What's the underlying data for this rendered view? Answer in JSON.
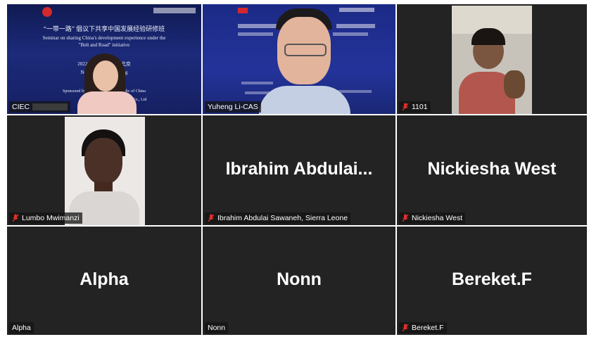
{
  "tiles": [
    {
      "name": "CIEC",
      "muted": false
    },
    {
      "name": "Yuheng Li-CAS",
      "muted": false
    },
    {
      "name": "1101",
      "muted": true
    },
    {
      "name": "Lumbo Mwimanzi",
      "muted": true
    },
    {
      "name": "Ibrahim Abdulai Sawaneh, Sierra Leone",
      "muted": true,
      "display": "Ibrahim  Abdulai..."
    },
    {
      "name": "Nickiesha West",
      "muted": true,
      "display": "Nickiesha West"
    },
    {
      "name": "Alpha",
      "muted": false,
      "display": "Alpha"
    },
    {
      "name": "Nonn",
      "muted": false,
      "display": "Nonn"
    },
    {
      "name": "Bereket.F",
      "muted": true,
      "display": "Bereket.F"
    }
  ],
  "slide": {
    "title_cn": "“一带一路” 倡议下共享中国发展经验研修班",
    "title_en_1": "Seminar on sharing China's development experience under the",
    "title_en_2": "\"Belt and Road\"  initiative",
    "date": "2022年11         1日  中国 · 北京",
    "date_en": "Nov 1st              China  ·  Beijing",
    "sponsor": "Sponsored by: Ministry of              le's Republic of China",
    "sponsor_2": "ms Co., Ltd"
  },
  "colors": {
    "tile_bg": "#232323",
    "active_border": "#d9e04b",
    "muted_icon": "#e0302a"
  }
}
